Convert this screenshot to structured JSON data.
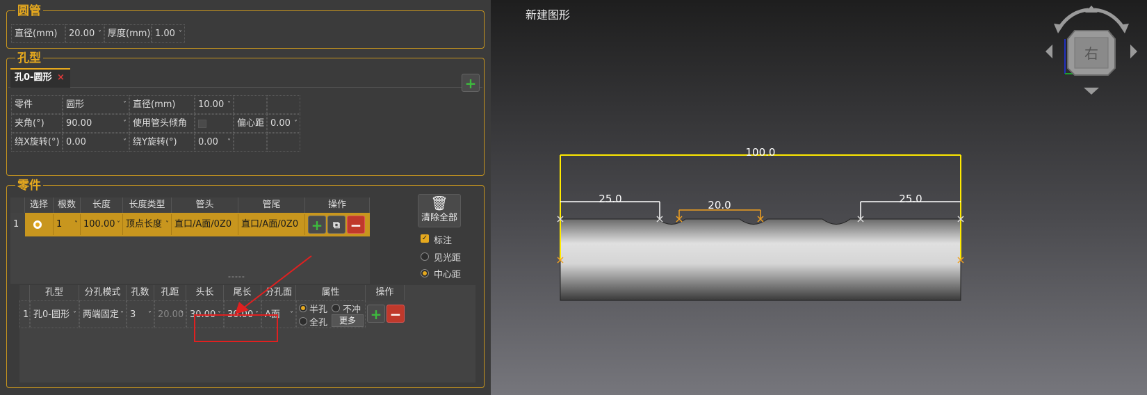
{
  "tube": {
    "title": "圆管",
    "diameter_label": "直径(mm)",
    "diameter_value": "20.00",
    "thickness_label": "厚度(mm)",
    "thickness_value": "1.00"
  },
  "hole_type": {
    "title": "孔型",
    "tab_label": "孔0-圆形",
    "tab_close": "×",
    "add_icon": "+",
    "fields": {
      "part_label": "零件",
      "part_value": "圆形",
      "diameter_label": "直径(mm)",
      "diameter_value": "10.00",
      "angle_label": "夹角(°)",
      "angle_value": "90.00",
      "use_tilt_label": "使用管头倾角",
      "offset_label": "偏心距",
      "offset_value": "0.00",
      "rotx_label": "绕X旋转(°)",
      "rotx_value": "0.00",
      "roty_label": "绕Y旋转(°)",
      "roty_value": "0.00"
    }
  },
  "parts": {
    "title": "零件",
    "columns": [
      "选择",
      "根数",
      "长度",
      "长度类型",
      "管头",
      "管尾",
      "操作"
    ],
    "row": {
      "index": "1",
      "count": "1",
      "length": "100.00",
      "length_type": "顶点长度",
      "head": "直口/A面/0Z0",
      "tail": "直口/A面/0Z0"
    },
    "clear_all": "清除全部",
    "annotate_label": "标注",
    "radio_light": "见光距",
    "radio_center": "中心距",
    "splitter": "-----"
  },
  "hole_table": {
    "columns": [
      "孔型",
      "分孔模式",
      "孔数",
      "孔距",
      "头长",
      "尾长",
      "分孔面",
      "属性",
      "操作"
    ],
    "row": {
      "index": "1",
      "hole_type": "孔0-圆形",
      "mode": "两端固定",
      "count": "3",
      "spacing": "20.00",
      "head_len": "30.00",
      "tail_len": "30.00",
      "face": "A面",
      "half_hole": "半孔",
      "no_punch": "不冲",
      "full_hole": "全孔",
      "more": "更多"
    }
  },
  "viewport": {
    "title": "新建图形",
    "view_cube_label": "右",
    "dims": {
      "total": "100.0",
      "left": "25.0",
      "middle": "20.0",
      "right": "25.0"
    }
  },
  "colors": {
    "accent": "#e6a91e",
    "border": "#c8961e",
    "dim_yellow": "#ffea00",
    "dim_orange": "#f0a020",
    "highlight_red": "#e02020"
  }
}
